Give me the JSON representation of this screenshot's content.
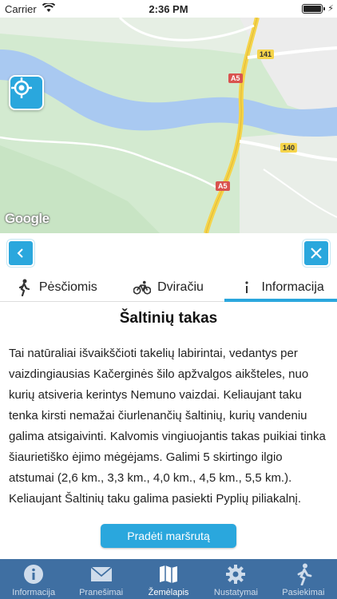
{
  "status_bar": {
    "carrier": "Carrier",
    "time": "2:36 PM"
  },
  "map": {
    "attribution": "Google",
    "road_labels": [
      "141",
      "A5",
      "140",
      "A5"
    ],
    "colors": {
      "land": "#d3ead0",
      "water": "#a9c9f1",
      "road": "#ffffff",
      "road_major": "#f5d44a"
    }
  },
  "controls": {
    "back_icon": "chevron-left-icon",
    "close_icon": "close-icon"
  },
  "tabs": [
    {
      "label": "Pėsčiomis",
      "icon": "walker-icon",
      "active": false
    },
    {
      "label": "Dviračiu",
      "icon": "bicycle-icon",
      "active": false
    },
    {
      "label": "Informacija",
      "icon": "info-icon",
      "active": true
    }
  ],
  "content": {
    "title": "Šaltinių takas",
    "description": "Tai natūraliai išvaikščioti takelių labirintai, vedantys per vaizdingiausias Kačerginės šilo apžvalgos aikšteles, nuo kurių atsiveria kerintys Nemuno vaizdai. Keliaujant taku tenka kirsti nemažai čiurlenančių šaltinių, kurių vandeniu galima atsigaivinti. Kalvomis vingiuojantis takas puikiai tinka šiaurietiško ėjimo mėgėjams. Galimi 5 skirtingo ilgio atstumai (2,6 km., 3,3 km., 4,0 km., 4,5 km., 5,5 km.). Keliaujant Šaltinių taku galima pasiekti Pyplių piliakalnį.",
    "start_button": "Pradėti maršrutą"
  },
  "bottom_nav": [
    {
      "label": "Informacija",
      "icon": "info-circle-icon",
      "active": false
    },
    {
      "label": "Pranešimai",
      "icon": "envelope-icon",
      "active": false
    },
    {
      "label": "Žemėlapis",
      "icon": "map-icon",
      "active": true
    },
    {
      "label": "Nustatymai",
      "icon": "gear-icon",
      "active": false
    },
    {
      "label": "Pasiekimai",
      "icon": "runner-icon",
      "active": false
    }
  ],
  "accent_color": "#2aa7dd",
  "nav_color": "#3f6fa2"
}
